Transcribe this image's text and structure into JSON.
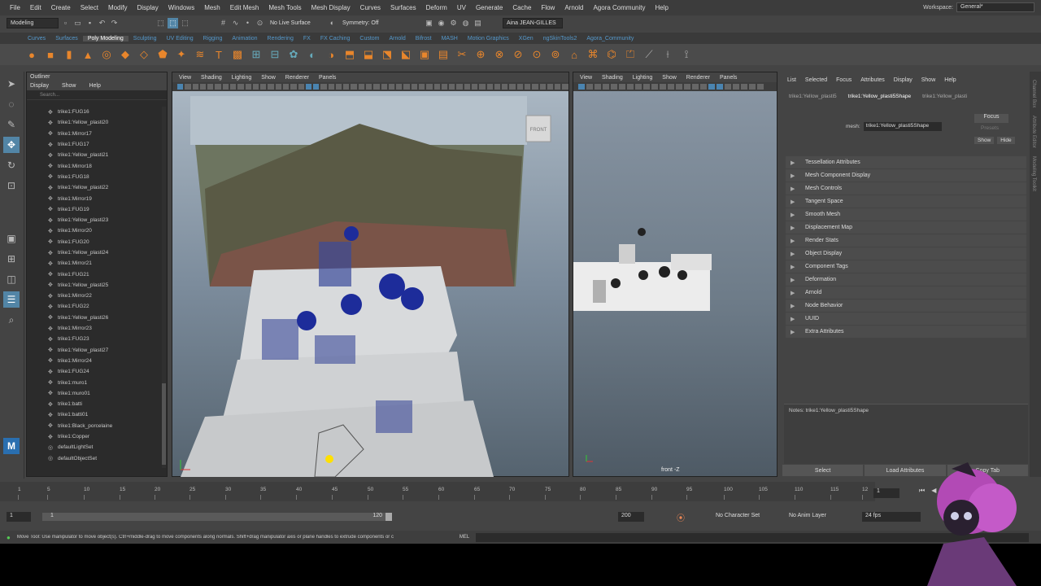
{
  "menubar": {
    "items": [
      "File",
      "Edit",
      "Create",
      "Select",
      "Modify",
      "Display",
      "Windows",
      "Mesh",
      "Edit Mesh",
      "Mesh Tools",
      "Mesh Display",
      "Curves",
      "Surfaces",
      "Deform",
      "UV",
      "Generate",
      "Cache",
      "Flow",
      "Arnold",
      "Agora Community",
      "Help"
    ],
    "workspace_label": "Workspace:",
    "workspace_value": "General*"
  },
  "statusline": {
    "mode": "Modeling",
    "live_surface": "No Live Surface",
    "symmetry": "Symmetry: Off",
    "user": "Aina JEAN-GILLES"
  },
  "shelf_tabs": [
    "Curves",
    "Surfaces",
    "Poly Modeling",
    "Sculpting",
    "UV Editing",
    "Rigging",
    "Animation",
    "Rendering",
    "FX",
    "FX Caching",
    "Custom",
    "Arnold",
    "Bifrost",
    "MASH",
    "Motion Graphics",
    "XGen",
    "ngSkinTools2",
    "Agora_Community"
  ],
  "shelf_active": "Poly Modeling",
  "outliner": {
    "title": "Outliner",
    "menus": [
      "Display",
      "Show",
      "Help"
    ],
    "search_placeholder": "Search...",
    "items": [
      "trike1:FUG16",
      "trike1:Yellow_plasti20",
      "trike1:Mirror17",
      "trike1:FUG17",
      "trike1:Yellow_plasti21",
      "trike1:Mirror18",
      "trike1:FUG18",
      "trike1:Yellow_plasti22",
      "trike1:Mirror19",
      "trike1:FUG19",
      "trike1:Yellow_plasti23",
      "trike1:Mirror20",
      "trike1:FUG20",
      "trike1:Yellow_plasti24",
      "trike1:Mirror21",
      "trike1:FUG21",
      "trike1:Yellow_plasti25",
      "trike1:Mirror22",
      "trike1:FUG22",
      "trike1:Yellow_plasti26",
      "trike1:Mirror23",
      "trike1:FUG23",
      "trike1:Yellow_plasti27",
      "trike1:Mirror24",
      "trike1:FUG24",
      "trike1:muro1",
      "trike1:muro01",
      "trike1:batti",
      "trike1:batti01",
      "trike1:Black_porcelaine",
      "trike1:Copper",
      "defaultLightSet",
      "defaultObjectSet"
    ]
  },
  "viewport_left": {
    "menus": [
      "View",
      "Shading",
      "Lighting",
      "Show",
      "Renderer",
      "Panels"
    ],
    "cube_label": "FRONT"
  },
  "viewport_right": {
    "menus": [
      "View",
      "Shading",
      "Lighting",
      "Show",
      "Renderer",
      "Panels"
    ],
    "camera_label": "front -Z"
  },
  "attribute_editor": {
    "menus": [
      "List",
      "Selected",
      "Focus",
      "Attributes",
      "Display",
      "Show",
      "Help"
    ],
    "tabs": [
      "trike1:Yellow_plasti5",
      "trike1:Yellow_plasti5Shape",
      "trike1:Yellow_plasti"
    ],
    "mesh_label": "mesh:",
    "mesh_value": "trike1:Yellow_plasti5Shape",
    "focus": "Focus",
    "presets": "Presets",
    "show": "Show",
    "hide": "Hide",
    "sections": [
      "Tessellation Attributes",
      "Mesh Component Display",
      "Mesh Controls",
      "Tangent Space",
      "Smooth Mesh",
      "Displacement Map",
      "Render Stats",
      "Object Display",
      "Component Tags",
      "Deformation",
      "Arnold",
      "Node Behavior",
      "UUID",
      "Extra Attributes"
    ],
    "notes": "Notes:  trike1:Yellow_plasti5Shape",
    "buttons": [
      "Select",
      "Load Attributes",
      "Copy Tab"
    ]
  },
  "timeslider": {
    "ticks": [
      "1",
      "5",
      "10",
      "15",
      "20",
      "25",
      "30",
      "35",
      "40",
      "45",
      "50",
      "55",
      "60",
      "65",
      "70",
      "75",
      "80",
      "85",
      "90",
      "95",
      "100",
      "105",
      "110",
      "115",
      "12"
    ],
    "current_frame": "1"
  },
  "rangeslider": {
    "start": "1",
    "start_inner": "1",
    "end_inner": "120",
    "end": "200",
    "character_set": "No Character Set",
    "anim_layer": "No Anim Layer",
    "fps": "24 fps"
  },
  "helpline": {
    "text": "Move Tool: Use manipulator to move object(s). Ctrl+middle-drag to move components along normals. Shift+drag manipulator axis or plane handles to extrude components or c",
    "mel": "MEL"
  },
  "colors": {
    "accent": "#5285a6",
    "shelf_tab": "#5599cc",
    "panel": "#444444",
    "outliner_bg": "#2b2b2b"
  }
}
